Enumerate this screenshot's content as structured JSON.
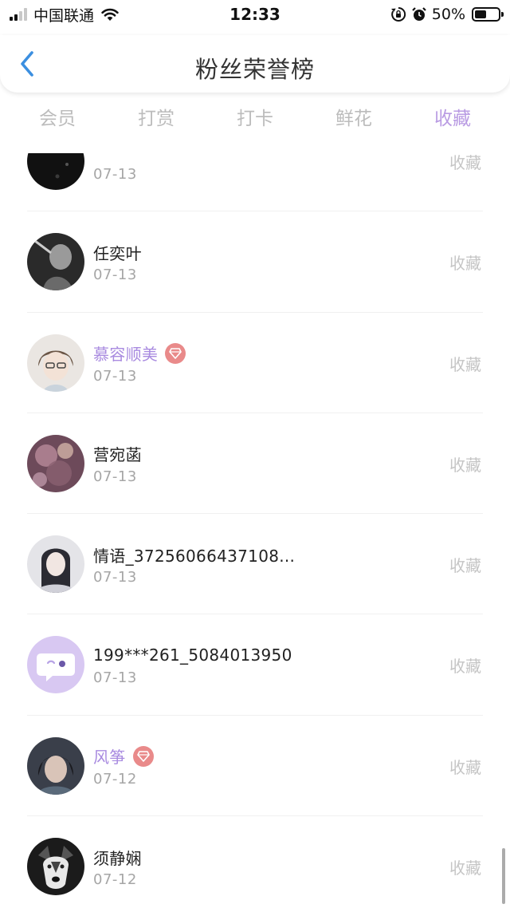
{
  "status_bar": {
    "carrier": "中国联通",
    "time": "12:33",
    "battery_percent_label": "50%",
    "battery_level": 0.5,
    "icons": [
      "signal-icon",
      "wifi-icon",
      "rotation-lock-icon",
      "alarm-icon",
      "battery-icon"
    ]
  },
  "header": {
    "title": "粉丝荣誉榜",
    "back_icon": "chevron-left-icon"
  },
  "tabs": [
    {
      "label": "会员",
      "active": false
    },
    {
      "label": "打赏",
      "active": false
    },
    {
      "label": "打卡",
      "active": false
    },
    {
      "label": "鲜花",
      "active": false
    },
    {
      "label": "收藏",
      "active": true
    }
  ],
  "colors": {
    "accent": "#b99be3",
    "vip_name": "#a98be0",
    "vip_badge": "#e98a8a",
    "date": "#a6a6a6",
    "action": "#c5c5c5"
  },
  "list": {
    "rows": [
      {
        "name": "",
        "vip": false,
        "date": "07-13",
        "action": "收藏"
      },
      {
        "name": "任奕叶",
        "vip": false,
        "date": "07-13",
        "action": "收藏"
      },
      {
        "name": "慕容顺美",
        "vip": true,
        "date": "07-13",
        "action": "收藏"
      },
      {
        "name": "营宛菡",
        "vip": false,
        "date": "07-13",
        "action": "收藏"
      },
      {
        "name": "情语_37256066437108...",
        "vip": false,
        "date": "07-13",
        "action": "收藏"
      },
      {
        "name": "199***261_5084013950",
        "vip": false,
        "date": "07-13",
        "action": "收藏"
      },
      {
        "name": "风筝",
        "vip": true,
        "date": "07-12",
        "action": "收藏"
      },
      {
        "name": "须静娴",
        "vip": false,
        "date": "07-12",
        "action": "收藏"
      }
    ]
  }
}
